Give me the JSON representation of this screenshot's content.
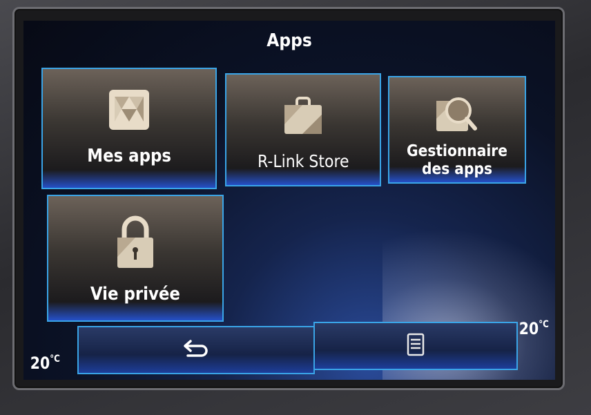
{
  "header": {
    "title": "Apps"
  },
  "tiles": [
    {
      "id": "mes-apps",
      "label": "Mes apps",
      "icon": "apps-grid-icon"
    },
    {
      "id": "rlink-store",
      "label": "R-Link Store",
      "icon": "shopping-bag-icon"
    },
    {
      "id": "gestionnaire",
      "label": "Gestionnaire des apps",
      "icon": "app-manager-search-icon"
    },
    {
      "id": "vie-privee",
      "label": "Vie privée",
      "icon": "lock-icon"
    }
  ],
  "bottom_bar": {
    "back_icon": "back-arrow-icon",
    "menu_icon": "menu-list-icon"
  },
  "status": {
    "temp_left": "20",
    "temp_right": "20",
    "temp_unit": "°C"
  },
  "colors": {
    "accent_border": "#3aa5e8",
    "tile_highlight": "#2550c8",
    "background": "#0b1226"
  }
}
